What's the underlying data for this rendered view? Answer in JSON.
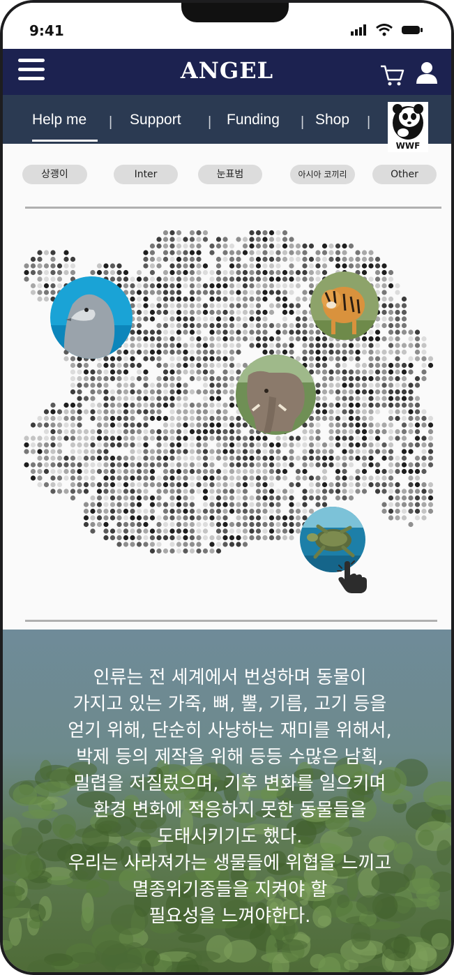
{
  "status": {
    "time": "9:41",
    "icons": [
      "signal-icon",
      "wifi-icon",
      "battery-icon"
    ]
  },
  "navbar": {
    "brand": "ANGEL",
    "bg": "#1c2250"
  },
  "tabs": [
    {
      "label": "Help me",
      "active": true
    },
    {
      "label": "Support"
    },
    {
      "label": "Funding"
    },
    {
      "label": "Shop"
    }
  ],
  "tab_separator": "|",
  "partner_logo": {
    "text": "WWF"
  },
  "chips": [
    {
      "label": "상괭이"
    },
    {
      "label": "Inter"
    },
    {
      "label": "눈표범"
    },
    {
      "label": "아시아 코끼리"
    },
    {
      "label": "Other"
    }
  ],
  "map": {
    "animals": [
      {
        "name": "dolphin",
        "icon": "dolphin-photo"
      },
      {
        "name": "tiger",
        "icon": "tiger-photo"
      },
      {
        "name": "elephant",
        "icon": "elephant-photo"
      },
      {
        "name": "sea-turtle",
        "icon": "turtle-photo"
      }
    ],
    "cursor": "pointer-hand-icon"
  },
  "info": {
    "text": "인류는 전 세계에서 번성하며 동물이\n가지고 있는 가죽, 뼈, 뿔, 기름, 고기 등을\n얻기 위해, 단순히 사냥하는 재미를 위해서,\n박제 등의 제작을 위해 등등 수많은 남획,\n밀렵을 저질렀으며, 기후 변화를 일으키며\n환경 변화에 적응하지 못한 동물들을\n도태시키기도 했다.\n우리는 사라져가는 생물들에 위협을 느끼고\n멸종위기종들을 지켜야 할\n필요성을 느껴야한다."
  }
}
